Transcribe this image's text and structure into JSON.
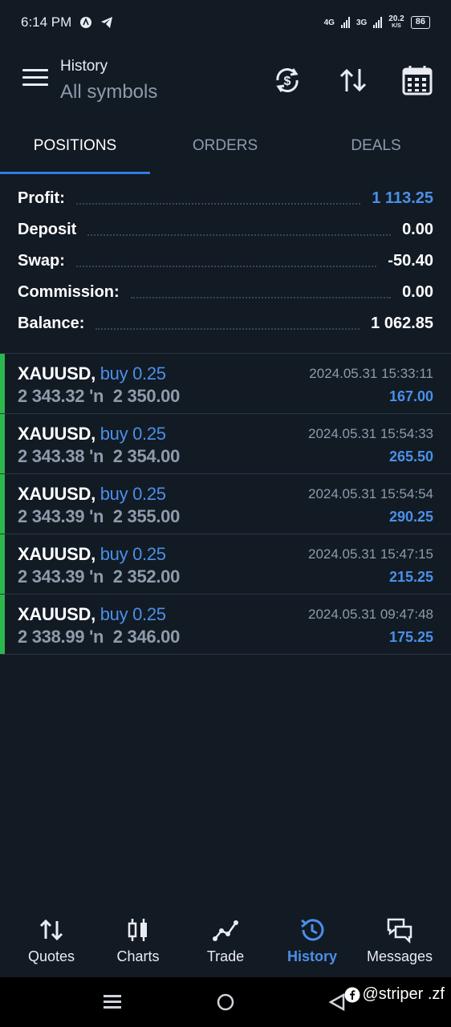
{
  "statusbar": {
    "time": "6:14 PM",
    "net1": "4G",
    "net2": "3G",
    "speed": "20.2",
    "speed_unit": "K/S",
    "battery": "86"
  },
  "header": {
    "subtitle": "History",
    "title": "All symbols"
  },
  "tabs": [
    {
      "label": "POSITIONS",
      "active": true
    },
    {
      "label": "ORDERS",
      "active": false
    },
    {
      "label": "DEALS",
      "active": false
    }
  ],
  "summary": [
    {
      "label": "Profit:",
      "value": "1 113.25"
    },
    {
      "label": "Deposit",
      "value": "0.00"
    },
    {
      "label": "Swap:",
      "value": "-50.40"
    },
    {
      "label": "Commission:",
      "value": "0.00"
    },
    {
      "label": "Balance:",
      "value": "1 062.85"
    }
  ],
  "positions": [
    {
      "symbol": "XAUUSD,",
      "side": "buy 0.25",
      "open": "2 343.32",
      "arrow": "'n",
      "close": "2 350.00",
      "time": "2024.05.31 15:33:11",
      "profit": "167.00"
    },
    {
      "symbol": "XAUUSD,",
      "side": "buy 0.25",
      "open": "2 343.38",
      "arrow": "'n",
      "close": "2 354.00",
      "time": "2024.05.31 15:54:33",
      "profit": "265.50"
    },
    {
      "symbol": "XAUUSD,",
      "side": "buy 0.25",
      "open": "2 343.39",
      "arrow": "'n",
      "close": "2 355.00",
      "time": "2024.05.31 15:54:54",
      "profit": "290.25"
    },
    {
      "symbol": "XAUUSD,",
      "side": "buy 0.25",
      "open": "2 343.39",
      "arrow": "'n",
      "close": "2 352.00",
      "time": "2024.05.31 15:47:15",
      "profit": "215.25"
    },
    {
      "symbol": "XAUUSD,",
      "side": "buy 0.25",
      "open": "2 338.99",
      "arrow": "'n",
      "close": "2 346.00",
      "time": "2024.05.31 09:47:48",
      "profit": "175.25"
    }
  ],
  "bottomnav": [
    {
      "label": "Quotes",
      "icon": "quotes-icon"
    },
    {
      "label": "Charts",
      "icon": "charts-icon"
    },
    {
      "label": "Trade",
      "icon": "trade-icon"
    },
    {
      "label": "History",
      "icon": "history-icon",
      "active": true
    },
    {
      "label": "Messages",
      "icon": "messages-icon"
    }
  ],
  "watermark": "@striper .zf",
  "colors": {
    "background": "#121a24",
    "accent": "#4a90e8",
    "buy_bar": "#2db84d",
    "muted": "#8e9bab"
  }
}
